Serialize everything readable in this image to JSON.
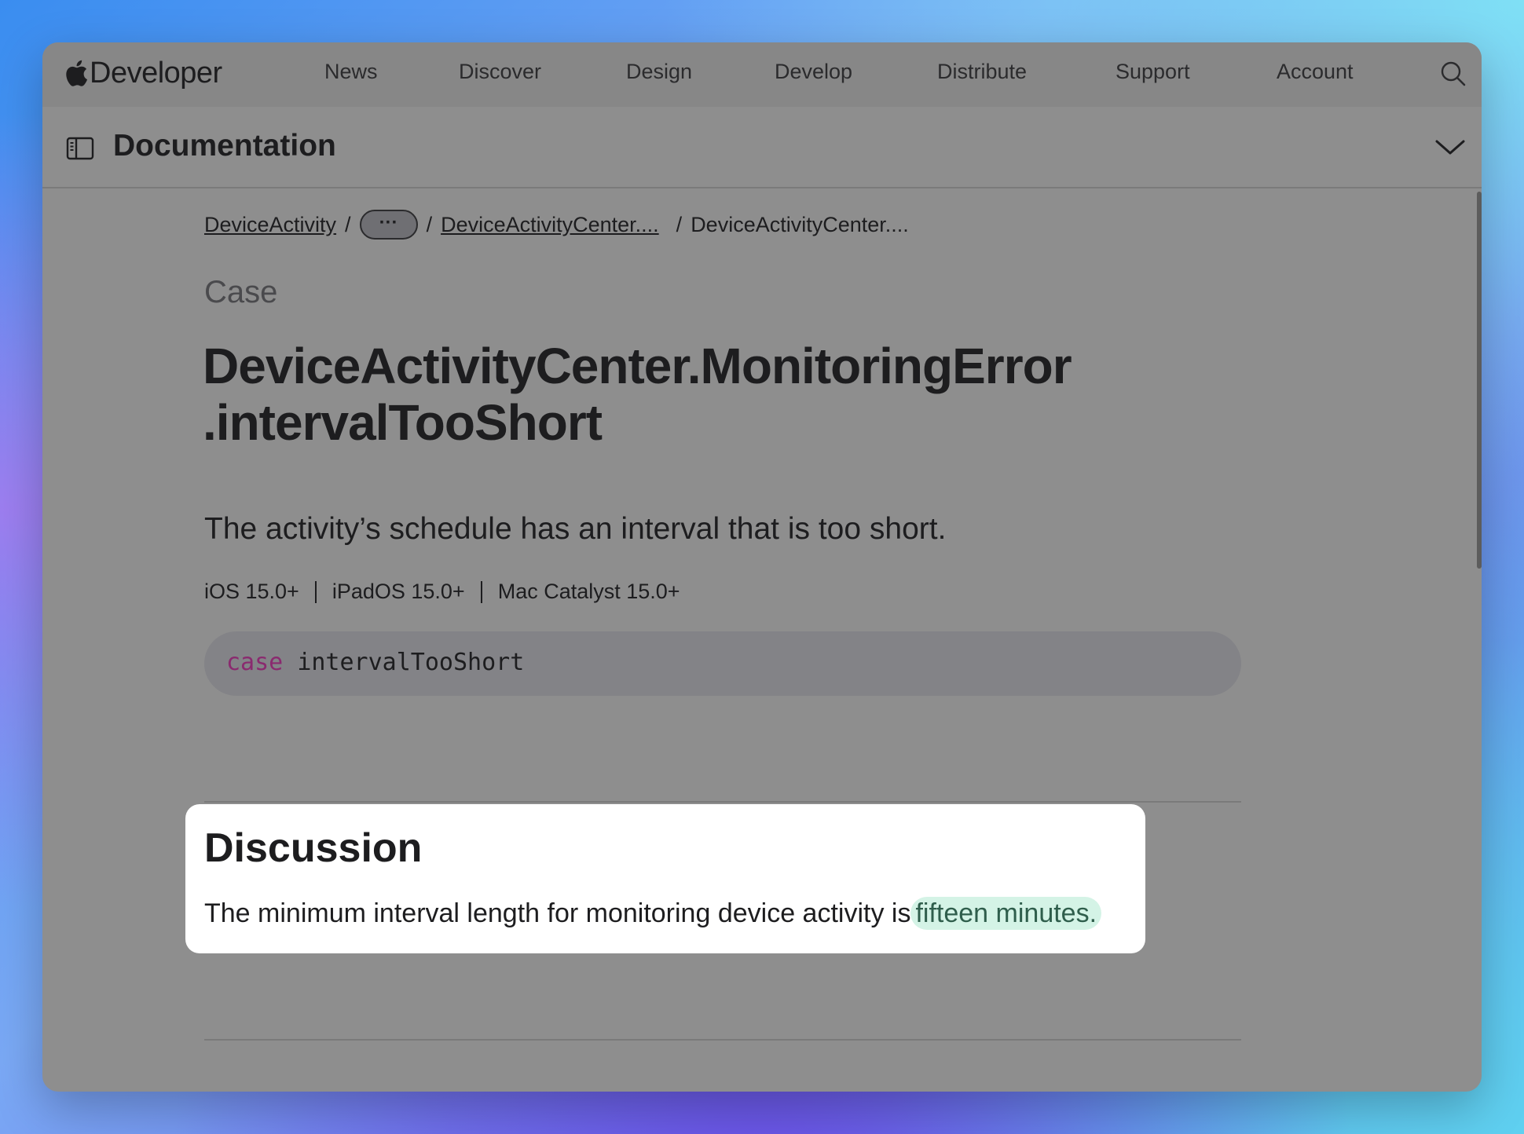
{
  "topnav": {
    "brand": "Developer",
    "items": [
      "News",
      "Discover",
      "Design",
      "Develop",
      "Distribute",
      "Support",
      "Account"
    ],
    "search_icon": "search-icon"
  },
  "docbar": {
    "title": "Documentation",
    "sidebar_icon": "sidebar-icon",
    "chevron_icon": "chevron-down-icon"
  },
  "breadcrumb": {
    "items": [
      "DeviceActivity",
      "···",
      "DeviceActivityCenter....",
      "DeviceActivityCenter...."
    ],
    "separator": "/"
  },
  "symbol": {
    "kind": "Case",
    "title_line1": "DeviceActivityCenter.MonitoringError",
    "title_line2": ".intervalTooShort",
    "abstract": "The activity’s schedule has an interval that is too short.",
    "platforms": [
      "iOS 15.0+",
      "iPadOS 15.0+",
      "Mac Catalyst 15.0+"
    ]
  },
  "declaration": {
    "keyword": "case",
    "name": "intervalTooShort"
  },
  "discussion": {
    "title": "Discussion",
    "text_prefix": "The minimum interval length for monitoring device activity is",
    "text_highlight": "fifteen minutes."
  },
  "colors": {
    "window_bg": "#8e8e8e",
    "keyword": "#8a2a6f",
    "highlight": "#d4f3e6"
  }
}
